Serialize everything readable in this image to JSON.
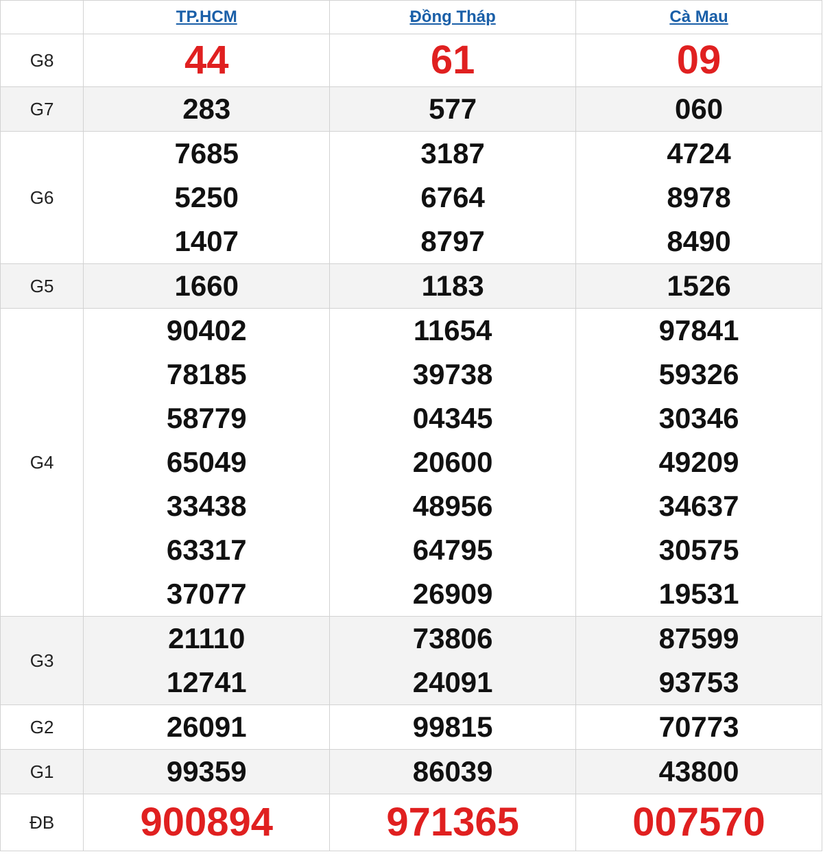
{
  "header": {
    "provinces": [
      "TP.HCM",
      "Đồng Tháp",
      "Cà Mau"
    ]
  },
  "colors": {
    "link": "#1a5fa8",
    "highlight": "#e02020",
    "shade": "#f3f3f3"
  },
  "prizes": [
    {
      "label": "G8",
      "results": [
        [
          "44"
        ],
        [
          "61"
        ],
        [
          "09"
        ]
      ]
    },
    {
      "label": "G7",
      "results": [
        [
          "283"
        ],
        [
          "577"
        ],
        [
          "060"
        ]
      ]
    },
    {
      "label": "G6",
      "results": [
        [
          "7685",
          "5250",
          "1407"
        ],
        [
          "3187",
          "6764",
          "8797"
        ],
        [
          "4724",
          "8978",
          "8490"
        ]
      ]
    },
    {
      "label": "G5",
      "results": [
        [
          "1660"
        ],
        [
          "1183"
        ],
        [
          "1526"
        ]
      ]
    },
    {
      "label": "G4",
      "results": [
        [
          "90402",
          "78185",
          "58779",
          "65049",
          "33438",
          "63317",
          "37077"
        ],
        [
          "11654",
          "39738",
          "04345",
          "20600",
          "48956",
          "64795",
          "26909"
        ],
        [
          "97841",
          "59326",
          "30346",
          "49209",
          "34637",
          "30575",
          "19531"
        ]
      ]
    },
    {
      "label": "G3",
      "results": [
        [
          "21110",
          "12741"
        ],
        [
          "73806",
          "24091"
        ],
        [
          "87599",
          "93753"
        ]
      ]
    },
    {
      "label": "G2",
      "results": [
        [
          "26091"
        ],
        [
          "99815"
        ],
        [
          "70773"
        ]
      ]
    },
    {
      "label": "G1",
      "results": [
        [
          "99359"
        ],
        [
          "86039"
        ],
        [
          "43800"
        ]
      ]
    },
    {
      "label": "ĐB",
      "results": [
        [
          "900894"
        ],
        [
          "971365"
        ],
        [
          "007570"
        ]
      ]
    }
  ]
}
